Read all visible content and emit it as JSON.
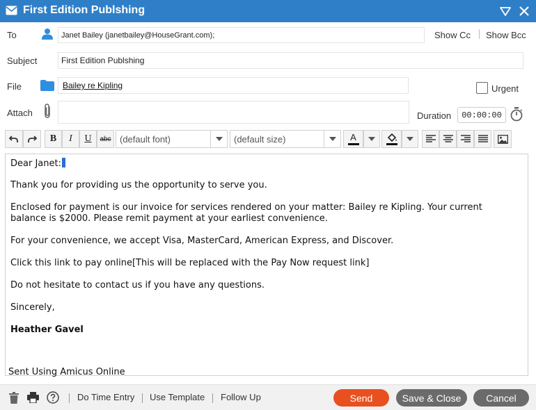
{
  "window": {
    "title": "First Edition Publshing"
  },
  "form": {
    "to_label": "To",
    "to_value": "Janet Bailey (janetbailey@HouseGrant.com);",
    "show_cc": "Show Cc",
    "show_bcc": "Show Bcc",
    "subject_label": "Subject",
    "subject_value": "First Edition Publshing",
    "file_label": "File",
    "file_value": "Bailey re Kipling",
    "urgent_label": "Urgent",
    "attach_label": "Attach",
    "duration_label": "Duration",
    "duration_value": "00:00:00"
  },
  "toolbar": {
    "font_placeholder": "(default font)",
    "size_placeholder": "(default size)",
    "bold": "B",
    "italic": "I",
    "underline": "U",
    "strike": "abc"
  },
  "editor": {
    "greeting": "Dear Janet:",
    "p1": "Thank you for providing us the opportunity to serve you.",
    "p2": "Enclosed for payment is our invoice for services rendered on your matter: Bailey re Kipling. Your current balance is $2000. Please remit payment at your earliest convenience.",
    "p3": "For your convenience, we accept Visa, MasterCard, American Express, and Discover.",
    "p4": "Click this link to pay online[This will be replaced with the Pay Now request link]",
    "p5": "Do not hesitate to contact us if you have any questions.",
    "closing": "Sincerely,",
    "signature": "Heather Gavel",
    "footer_note": "Sent Using Amicus Online"
  },
  "footer": {
    "do_time_entry": "Do Time Entry",
    "use_template": "Use Template",
    "follow_up": "Follow Up",
    "send": "Send",
    "save_close": "Save & Close",
    "cancel": "Cancel"
  },
  "colors": {
    "titlebar": "#2f7fc8",
    "send": "#e8501f",
    "secondary_button": "#6b6b6b",
    "folder": "#2f8ee0"
  }
}
